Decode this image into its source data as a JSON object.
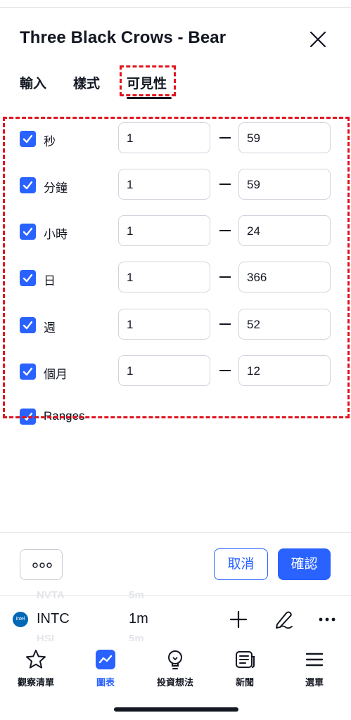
{
  "dialog": {
    "title": "Three Black Crows - Bear"
  },
  "tabs": [
    {
      "label": "輸入"
    },
    {
      "label": "樣式"
    },
    {
      "label": "可見性"
    }
  ],
  "active_tab": "可見性",
  "visibility_rows": [
    {
      "label": "秒",
      "checked": true,
      "from": "1",
      "to": "59"
    },
    {
      "label": "分鐘",
      "checked": true,
      "from": "1",
      "to": "59"
    },
    {
      "label": "小時",
      "checked": true,
      "from": "1",
      "to": "24"
    },
    {
      "label": "日",
      "checked": true,
      "from": "1",
      "to": "366"
    },
    {
      "label": "週",
      "checked": true,
      "from": "1",
      "to": "52"
    },
    {
      "label": "個月",
      "checked": true,
      "from": "1",
      "to": "12"
    },
    {
      "label": "Ranges",
      "checked": true
    }
  ],
  "footer": {
    "cancel_label": "取消",
    "confirm_label": "確認"
  },
  "ticker": {
    "symbol": "INTC",
    "interval": "1m",
    "logo_text": "intel",
    "ghost_above_symbol": "NVTA",
    "ghost_above_interval": "5m",
    "ghost_below_symbol": "HSI",
    "ghost_below_interval": "5m"
  },
  "bottom_nav": [
    {
      "label": "觀察清單",
      "icon": "star-icon",
      "active": false
    },
    {
      "label": "圖表",
      "icon": "chart-icon",
      "active": true
    },
    {
      "label": "投資想法",
      "icon": "lightbulb-icon",
      "active": false
    },
    {
      "label": "新聞",
      "icon": "newspaper-icon",
      "active": false
    },
    {
      "label": "選單",
      "icon": "hamburger-menu-icon",
      "active": false
    }
  ],
  "colors": {
    "accent": "#2962ff",
    "text": "#131722",
    "annotation_red": "#e0141e",
    "border": "#d1d4dc"
  }
}
